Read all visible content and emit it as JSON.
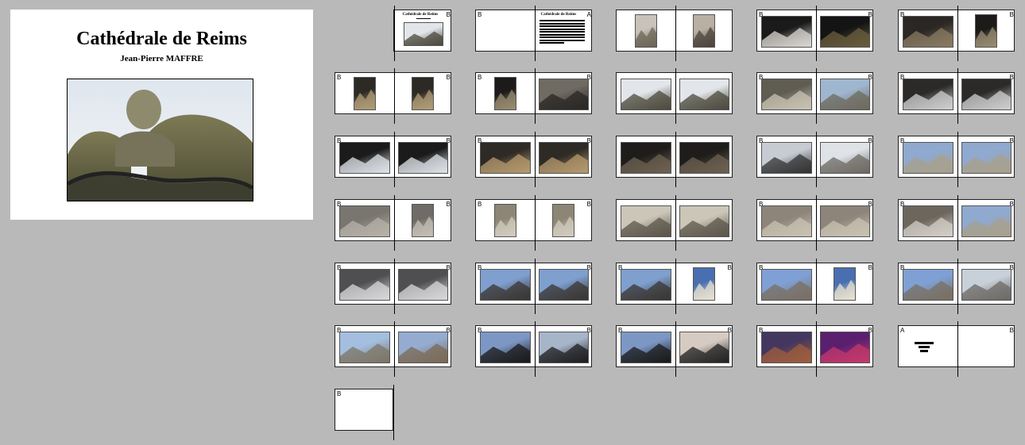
{
  "cover": {
    "title": "Cathédrale de Reims",
    "author": "Jean-Pierre MAFFRE"
  },
  "spreads": [
    {
      "row": 0,
      "col": 0,
      "left": {
        "type": "none",
        "mark": ""
      },
      "right": {
        "type": "title",
        "mark": "B",
        "title": "Cathédrale de Reims"
      }
    },
    {
      "row": 0,
      "col": 1,
      "left": {
        "type": "blank",
        "mark": "B"
      },
      "right": {
        "type": "text",
        "mark": "A",
        "title": "Cathédrale de Reims"
      }
    },
    {
      "row": 0,
      "col": 2,
      "left": {
        "type": "photo",
        "mark": "",
        "tone": "portrait-facade"
      },
      "right": {
        "type": "photo",
        "mark": "",
        "tone": "portrait-portal"
      }
    },
    {
      "row": 0,
      "col": 3,
      "left": {
        "type": "photo",
        "mark": "B",
        "tone": "dark-statue"
      },
      "right": {
        "type": "photo",
        "mark": "B",
        "tone": "dark-interior"
      }
    },
    {
      "row": 0,
      "col": 4,
      "left": {
        "type": "photo",
        "mark": "B",
        "tone": "nave"
      },
      "right": {
        "type": "photo",
        "mark": "B",
        "tone": "vault-portrait"
      }
    },
    {
      "row": 1,
      "col": 0,
      "left": {
        "type": "photo",
        "mark": "B",
        "tone": "nave-portrait"
      },
      "right": {
        "type": "photo",
        "mark": "B",
        "tone": "nave-portrait"
      }
    },
    {
      "row": 1,
      "col": 1,
      "left": {
        "type": "photo",
        "mark": "B",
        "tone": "vault-portrait"
      },
      "right": {
        "type": "photo",
        "mark": "B",
        "tone": "gothic"
      }
    },
    {
      "row": 1,
      "col": 2,
      "left": {
        "type": "photo",
        "mark": "",
        "tone": "gargoyle"
      },
      "right": {
        "type": "photo",
        "mark": "",
        "tone": "gargoyle"
      }
    },
    {
      "row": 1,
      "col": 3,
      "left": {
        "type": "photo",
        "mark": "B",
        "tone": "angel"
      },
      "right": {
        "type": "photo",
        "mark": "B",
        "tone": "angel-sky"
      }
    },
    {
      "row": 1,
      "col": 4,
      "left": {
        "type": "photo",
        "mark": "B",
        "tone": "windows"
      },
      "right": {
        "type": "photo",
        "mark": "B",
        "tone": "windows"
      }
    },
    {
      "row": 2,
      "col": 0,
      "left": {
        "type": "photo",
        "mark": "B",
        "tone": "cross-vault"
      },
      "right": {
        "type": "photo",
        "mark": "B",
        "tone": "cross-vault"
      }
    },
    {
      "row": 2,
      "col": 1,
      "left": {
        "type": "photo",
        "mark": "B",
        "tone": "roof-beams"
      },
      "right": {
        "type": "photo",
        "mark": "B",
        "tone": "roof-beams"
      }
    },
    {
      "row": 2,
      "col": 2,
      "left": {
        "type": "photo",
        "mark": "",
        "tone": "roof-dark"
      },
      "right": {
        "type": "photo",
        "mark": "",
        "tone": "roof-dark"
      }
    },
    {
      "row": 2,
      "col": 3,
      "left": {
        "type": "photo",
        "mark": "B",
        "tone": "crest"
      },
      "right": {
        "type": "photo",
        "mark": "B",
        "tone": "roof-slope"
      }
    },
    {
      "row": 2,
      "col": 4,
      "left": {
        "type": "photo",
        "mark": "B",
        "tone": "sky-stone"
      },
      "right": {
        "type": "photo",
        "mark": "B",
        "tone": "sky-stone"
      }
    },
    {
      "row": 3,
      "col": 0,
      "left": {
        "type": "photo",
        "mark": "B",
        "tone": "grey-wall"
      },
      "right": {
        "type": "photo",
        "mark": "B",
        "tone": "grey-wall-portrait"
      }
    },
    {
      "row": 3,
      "col": 1,
      "left": {
        "type": "photo",
        "mark": "B",
        "tone": "tower-portrait"
      },
      "right": {
        "type": "photo",
        "mark": "B",
        "tone": "tower-portrait"
      }
    },
    {
      "row": 3,
      "col": 2,
      "left": {
        "type": "photo",
        "mark": "",
        "tone": "towers"
      },
      "right": {
        "type": "photo",
        "mark": "",
        "tone": "towers"
      }
    },
    {
      "row": 3,
      "col": 3,
      "left": {
        "type": "photo",
        "mark": "B",
        "tone": "facade-detail"
      },
      "right": {
        "type": "photo",
        "mark": "B",
        "tone": "facade-detail"
      }
    },
    {
      "row": 3,
      "col": 4,
      "left": {
        "type": "photo",
        "mark": "B",
        "tone": "statues"
      },
      "right": {
        "type": "photo",
        "mark": "B",
        "tone": "sky-stone"
      }
    },
    {
      "row": 4,
      "col": 0,
      "left": {
        "type": "photo",
        "mark": "B",
        "tone": "roof-lines"
      },
      "right": {
        "type": "photo",
        "mark": "B",
        "tone": "roof-lines"
      }
    },
    {
      "row": 4,
      "col": 1,
      "left": {
        "type": "photo",
        "mark": "B",
        "tone": "spire-sky"
      },
      "right": {
        "type": "photo",
        "mark": "B",
        "tone": "spire-sky"
      }
    },
    {
      "row": 4,
      "col": 2,
      "left": {
        "type": "photo",
        "mark": "B",
        "tone": "spire-sky"
      },
      "right": {
        "type": "photo",
        "mark": "B",
        "tone": "cross-portrait"
      }
    },
    {
      "row": 4,
      "col": 3,
      "left": {
        "type": "photo",
        "mark": "B",
        "tone": "cross-sky"
      },
      "right": {
        "type": "photo",
        "mark": "B",
        "tone": "cross-portrait"
      }
    },
    {
      "row": 4,
      "col": 4,
      "left": {
        "type": "photo",
        "mark": "B",
        "tone": "cross-sky"
      },
      "right": {
        "type": "photo",
        "mark": "B",
        "tone": "pale-sky"
      }
    },
    {
      "row": 5,
      "col": 0,
      "left": {
        "type": "photo",
        "mark": "B",
        "tone": "statue-sky"
      },
      "right": {
        "type": "photo",
        "mark": "B",
        "tone": "spires-color"
      }
    },
    {
      "row": 5,
      "col": 1,
      "left": {
        "type": "photo",
        "mark": "B",
        "tone": "silhouette"
      },
      "right": {
        "type": "photo",
        "mark": "B",
        "tone": "silhouette-cloud"
      }
    },
    {
      "row": 5,
      "col": 2,
      "left": {
        "type": "photo",
        "mark": "B",
        "tone": "silhouette"
      },
      "right": {
        "type": "photo",
        "mark": "B",
        "tone": "silhouette-dusk"
      }
    },
    {
      "row": 5,
      "col": 3,
      "left": {
        "type": "photo",
        "mark": "B",
        "tone": "stained"
      },
      "right": {
        "type": "photo",
        "mark": "B",
        "tone": "magenta"
      }
    },
    {
      "row": 5,
      "col": 4,
      "left": {
        "type": "logo",
        "mark": "A"
      },
      "right": {
        "type": "blank",
        "mark": "B"
      }
    },
    {
      "row": 6,
      "col": 0,
      "left": {
        "type": "blank",
        "mark": "B"
      },
      "right": {
        "type": "none",
        "mark": ""
      }
    }
  ]
}
